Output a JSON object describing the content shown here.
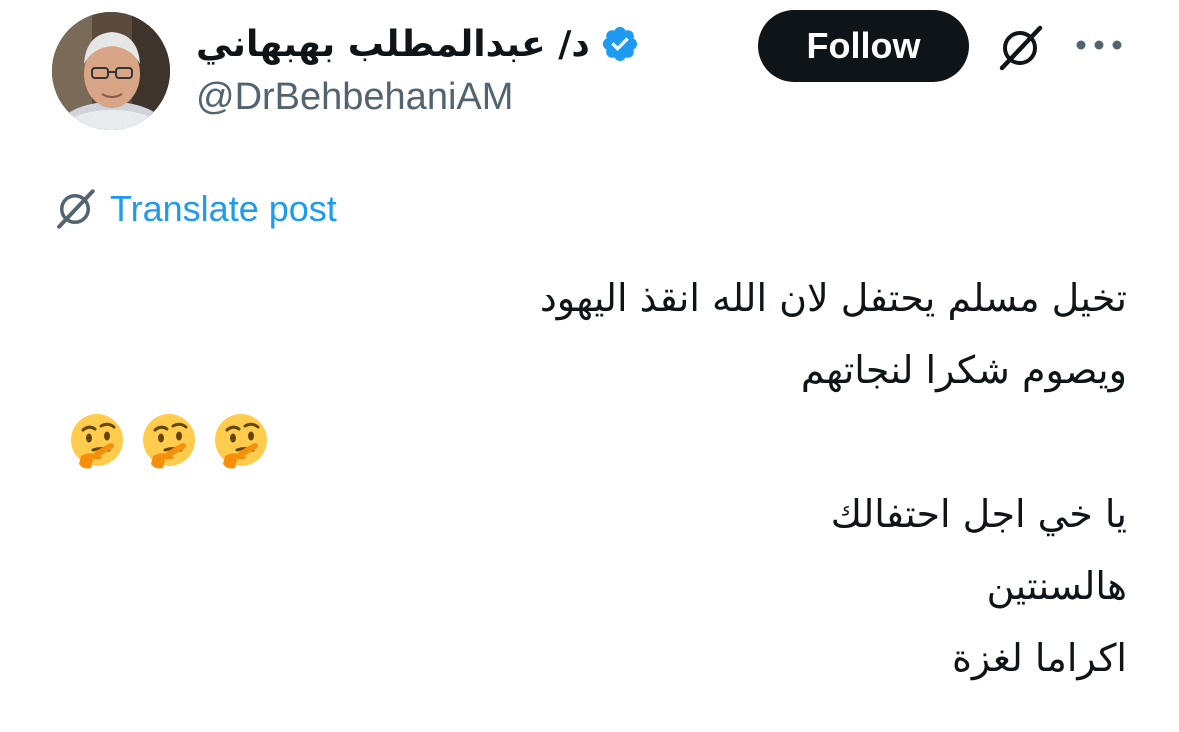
{
  "author": {
    "display_name": "د/ عبدالمطلب بهبهاني",
    "handle": "@DrBehbehaniAM",
    "verified": true,
    "verified_color": "#1d9bf0"
  },
  "actions": {
    "follow_label": "Follow",
    "grok_icon": "grok-icon",
    "more_icon": "more-icon"
  },
  "translate": {
    "label": "Translate post",
    "icon": "grok-translate-icon",
    "color": "#1d9bf0"
  },
  "post": {
    "lines": [
      "تخيل مسلم يحتفل لان الله انقذ اليهود",
      "ويصوم شكرا لنجاتهم",
      "",
      "يا خي اجل احتفالك",
      "هالسنتين",
      "اكراما لغزة"
    ],
    "emoji": [
      "thinking-face",
      "thinking-face",
      "thinking-face"
    ]
  },
  "colors": {
    "text": "#0f1419",
    "secondary": "#536471",
    "button_bg": "#0f1419"
  }
}
